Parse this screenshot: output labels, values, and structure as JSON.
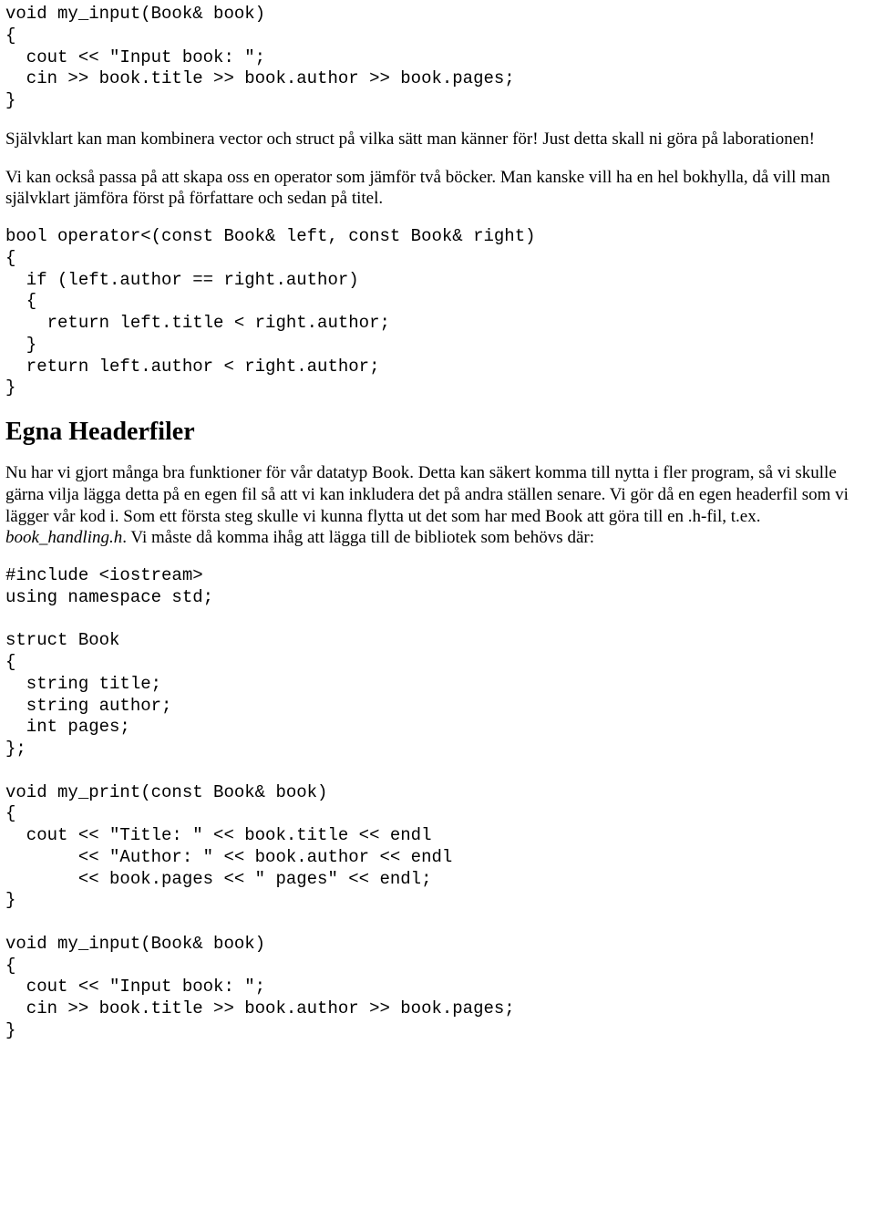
{
  "code1": "void my_input(Book& book)\n{\n  cout << \"Input book: \";\n  cin >> book.title >> book.author >> book.pages;\n}",
  "para1": "Självklart kan man kombinera vector och struct på vilka sätt man känner för! Just detta skall ni göra på laborationen!",
  "para2": "Vi kan också passa på att skapa oss en operator som jämför två böcker. Man kanske vill ha en hel bokhylla, då vill man självklart jämföra först på författare och sedan på titel.",
  "code2": "bool operator<(const Book& left, const Book& right)\n{\n  if (left.author == right.author)\n  {\n    return left.title < right.author;\n  }\n  return left.author < right.author;\n}",
  "heading": "Egna Headerfiler",
  "para3a": "Nu har vi gjort många bra funktioner för vår datatyp Book. Detta kan säkert komma till nytta i fler program, så vi skulle gärna vilja lägga detta på en egen fil så att vi kan inkludera det på andra ställen senare. Vi gör då en egen headerfil som vi lägger vår kod i. Som ett första steg skulle vi kunna flytta ut det som har med Book att göra till en .h-fil, t.ex. ",
  "para3em": "book_handling.h",
  "para3b": ". Vi måste då komma ihåg att lägga till de bibliotek som behövs där:",
  "code3": "#include <iostream>\nusing namespace std;\n\nstruct Book\n{\n  string title;\n  string author;\n  int pages;\n};\n\nvoid my_print(const Book& book)\n{\n  cout << \"Title: \" << book.title << endl\n       << \"Author: \" << book.author << endl\n       << book.pages << \" pages\" << endl;\n}\n\nvoid my_input(Book& book)\n{\n  cout << \"Input book: \";\n  cin >> book.title >> book.author >> book.pages;\n}"
}
